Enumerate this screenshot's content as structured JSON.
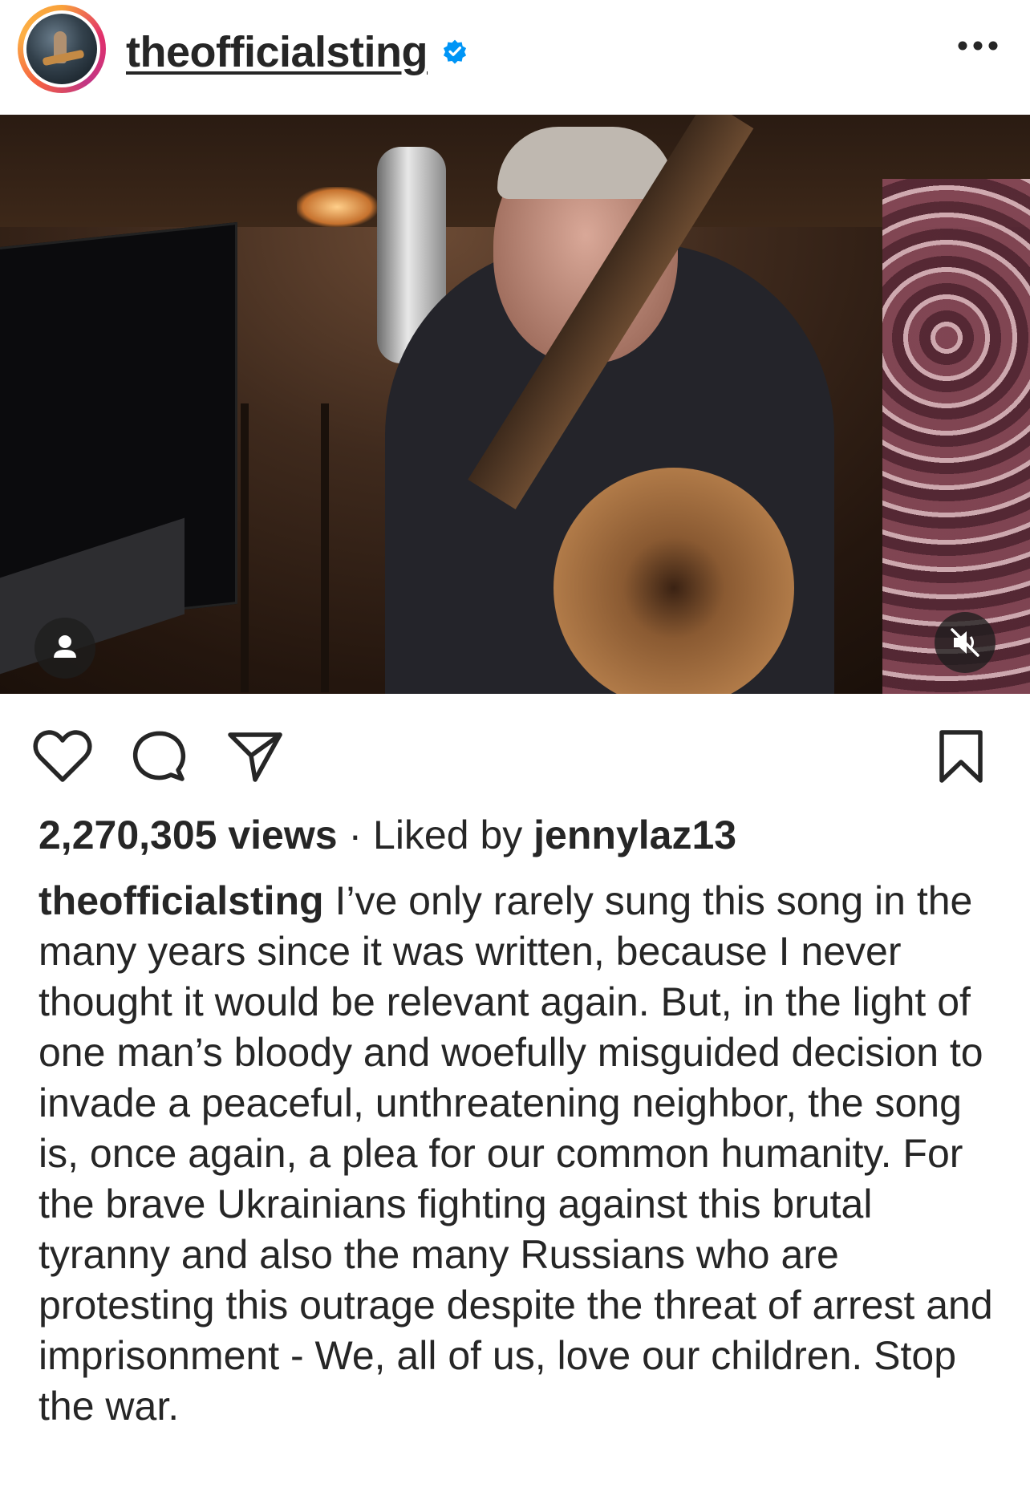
{
  "post": {
    "username": "theofficialsting",
    "verified": true,
    "more_icon": "more-horizontal-icon"
  },
  "media": {
    "type": "video",
    "user_tag_icon": "person-icon",
    "mute_icon": "speaker-muted-icon"
  },
  "actions": {
    "like_icon": "heart-icon",
    "comment_icon": "comment-icon",
    "share_icon": "paper-plane-icon",
    "save_icon": "bookmark-icon"
  },
  "stats": {
    "views": "2,270,305 views",
    "separator": "·",
    "liked_by_prefix": "Liked by",
    "liked_by_user": "jennylaz13"
  },
  "caption": {
    "author": "theofficialsting",
    "text": "I’ve only rarely sung this song in the many years since it was written, because I never thought it would be relevant again. But, in the light of one man’s bloody and woefully misguided decision to invade a peaceful, unthreatening neighbor, the song is, once again, a plea for our common humanity. For the brave Ukrainians fighting against this brutal tyranny and also the many Russians who are protesting this outrage despite the threat of arrest and imprisonment - We, all of us, love our children. Stop the war."
  },
  "colors": {
    "text": "#262626",
    "verified": "#0095f6",
    "background": "#ffffff"
  }
}
